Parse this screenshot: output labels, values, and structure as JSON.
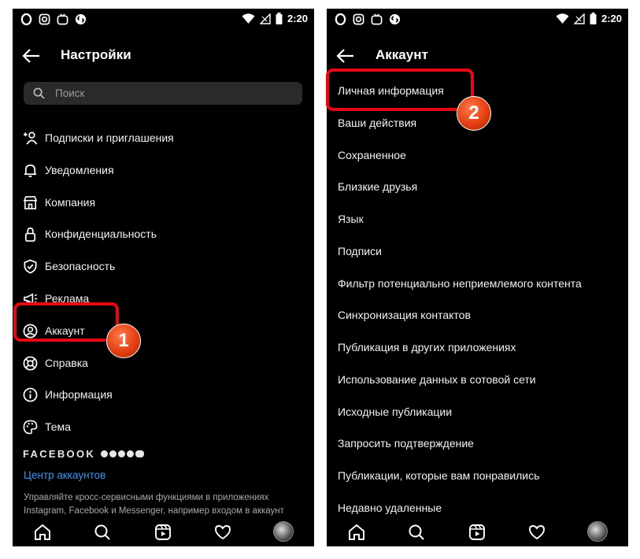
{
  "status_bar": {
    "time": "2:20"
  },
  "left_screen": {
    "title": "Настройки",
    "search_placeholder": "Поиск",
    "menu": [
      {
        "label": "Подписки и приглашения",
        "icon": "add-person-icon"
      },
      {
        "label": "Уведомления",
        "icon": "bell-icon"
      },
      {
        "label": "Компания",
        "icon": "store-icon"
      },
      {
        "label": "Конфиденциальность",
        "icon": "lock-icon"
      },
      {
        "label": "Безопасность",
        "icon": "shield-icon"
      },
      {
        "label": "Реклама",
        "icon": "megaphone-icon"
      },
      {
        "label": "Аккаунт",
        "icon": "account-circle-icon"
      },
      {
        "label": "Справка",
        "icon": "lifebuoy-icon"
      },
      {
        "label": "Информация",
        "icon": "info-icon"
      },
      {
        "label": "Тема",
        "icon": "palette-icon"
      }
    ],
    "facebook_label": "FACEBOOK",
    "accounts_center": "Центр аккаунтов",
    "accounts_desc": "Управляйте кросс-сервисными функциями в приложениях Instagram, Facebook и Messenger, например входом в аккаунт"
  },
  "right_screen": {
    "title": "Аккаунт",
    "items": [
      "Личная информация",
      "Ваши действия",
      "Сохраненное",
      "Близкие друзья",
      "Язык",
      "Подписи",
      "Фильтр потенциально неприемлемого контента",
      "Синхронизация контактов",
      "Публикация в других приложениях",
      "Использование данных в сотовой сети",
      "Исходные публикации",
      "Запросить подтверждение",
      "Публикации, которые вам понравились",
      "Недавно удаленные"
    ]
  },
  "annotations": {
    "step1": "1",
    "step2": "2",
    "highlight_color": "#e50914"
  },
  "colors": {
    "background": "#000000",
    "link": "#3897f0",
    "search_bg": "#2a2a2a"
  }
}
